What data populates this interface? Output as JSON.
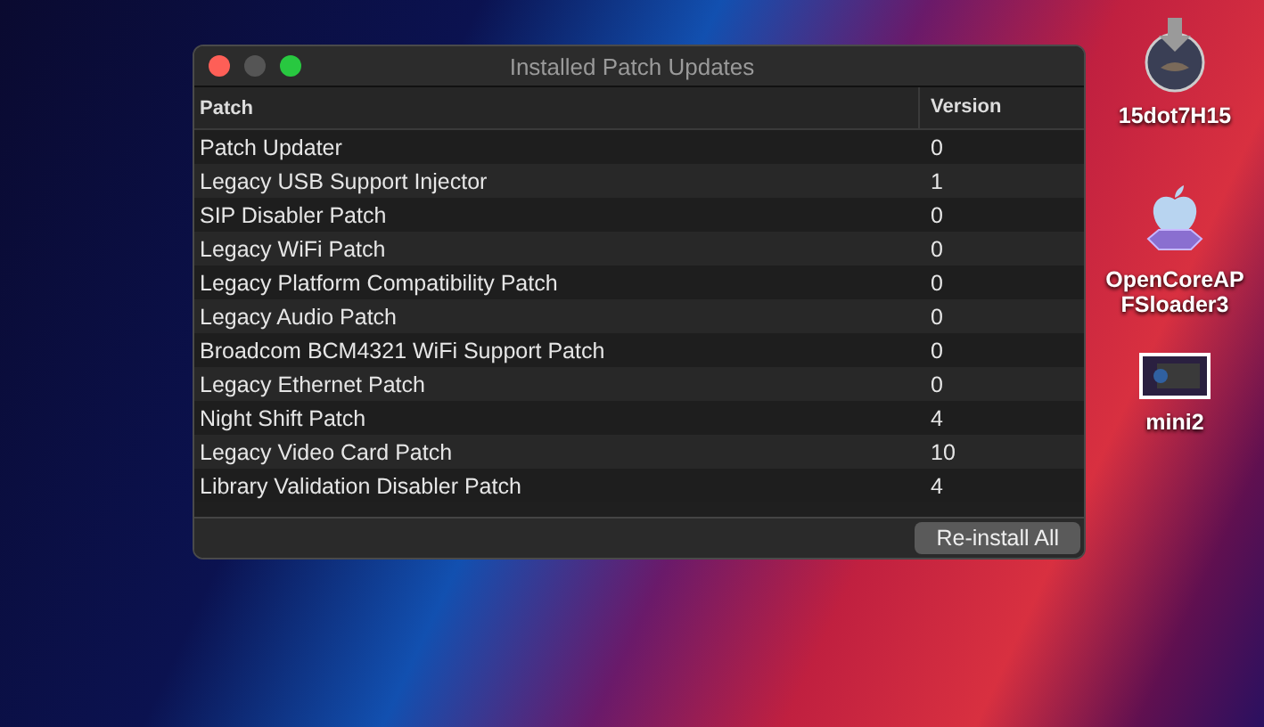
{
  "window": {
    "title": "Installed Patch Updates"
  },
  "table": {
    "columns": [
      "Patch",
      "Version"
    ],
    "rows": [
      {
        "patch": "Patch Updater",
        "version": "0"
      },
      {
        "patch": "Legacy USB Support Injector",
        "version": "1"
      },
      {
        "patch": "SIP Disabler Patch",
        "version": "0"
      },
      {
        "patch": "Legacy WiFi Patch",
        "version": "0"
      },
      {
        "patch": "Legacy Platform Compatibility Patch",
        "version": "0"
      },
      {
        "patch": "Legacy Audio Patch",
        "version": "0"
      },
      {
        "patch": "Broadcom BCM4321 WiFi Support Patch",
        "version": "0"
      },
      {
        "patch": "Legacy Ethernet Patch",
        "version": "0"
      },
      {
        "patch": "Night Shift Patch",
        "version": "4"
      },
      {
        "patch": "Legacy Video Card Patch",
        "version": "10"
      },
      {
        "patch": "Library Validation Disabler Patch",
        "version": "4"
      }
    ]
  },
  "buttons": [
    "Re-install All"
  ],
  "desktop_icons": [
    {
      "kind": "installer",
      "label": "15dot7H15"
    },
    {
      "kind": "app",
      "label": "OpenCoreAPFSloader3"
    },
    {
      "kind": "screenshot",
      "label": "mini2"
    }
  ]
}
